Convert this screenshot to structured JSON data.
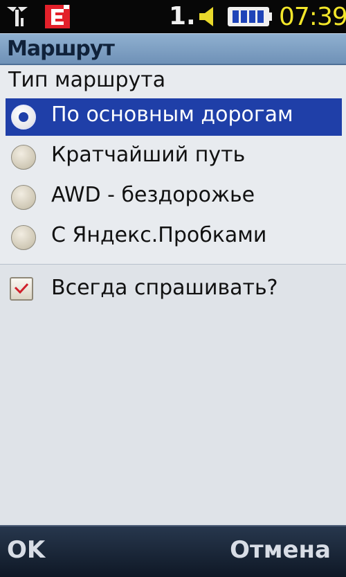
{
  "status_bar": {
    "sim_number": "1.",
    "time": "07:39",
    "icons": [
      "signal-antenna-icon",
      "e-network-icon",
      "sound-icon",
      "battery-icon"
    ],
    "time_color": "#f2e62a",
    "sim_dot_color": "#e0101a"
  },
  "title": "Маршрут",
  "section_label": "Тип маршрута",
  "options": [
    {
      "label": "По основным дорогам",
      "selected": true
    },
    {
      "label": "Кратчайший путь",
      "selected": false
    },
    {
      "label": "AWD - бездорожье",
      "selected": false
    },
    {
      "label": "С Яндекс.Пробками",
      "selected": false
    }
  ],
  "checkbox": {
    "label": "Всегда спрашивать?",
    "checked": true
  },
  "softkeys": {
    "left": "OK",
    "right": "Отмена"
  },
  "colors": {
    "selection": "#1f3fa8",
    "title_bar": "#7f9fc4",
    "background": "#dfe3e8",
    "check_mark": "#d0202a"
  }
}
